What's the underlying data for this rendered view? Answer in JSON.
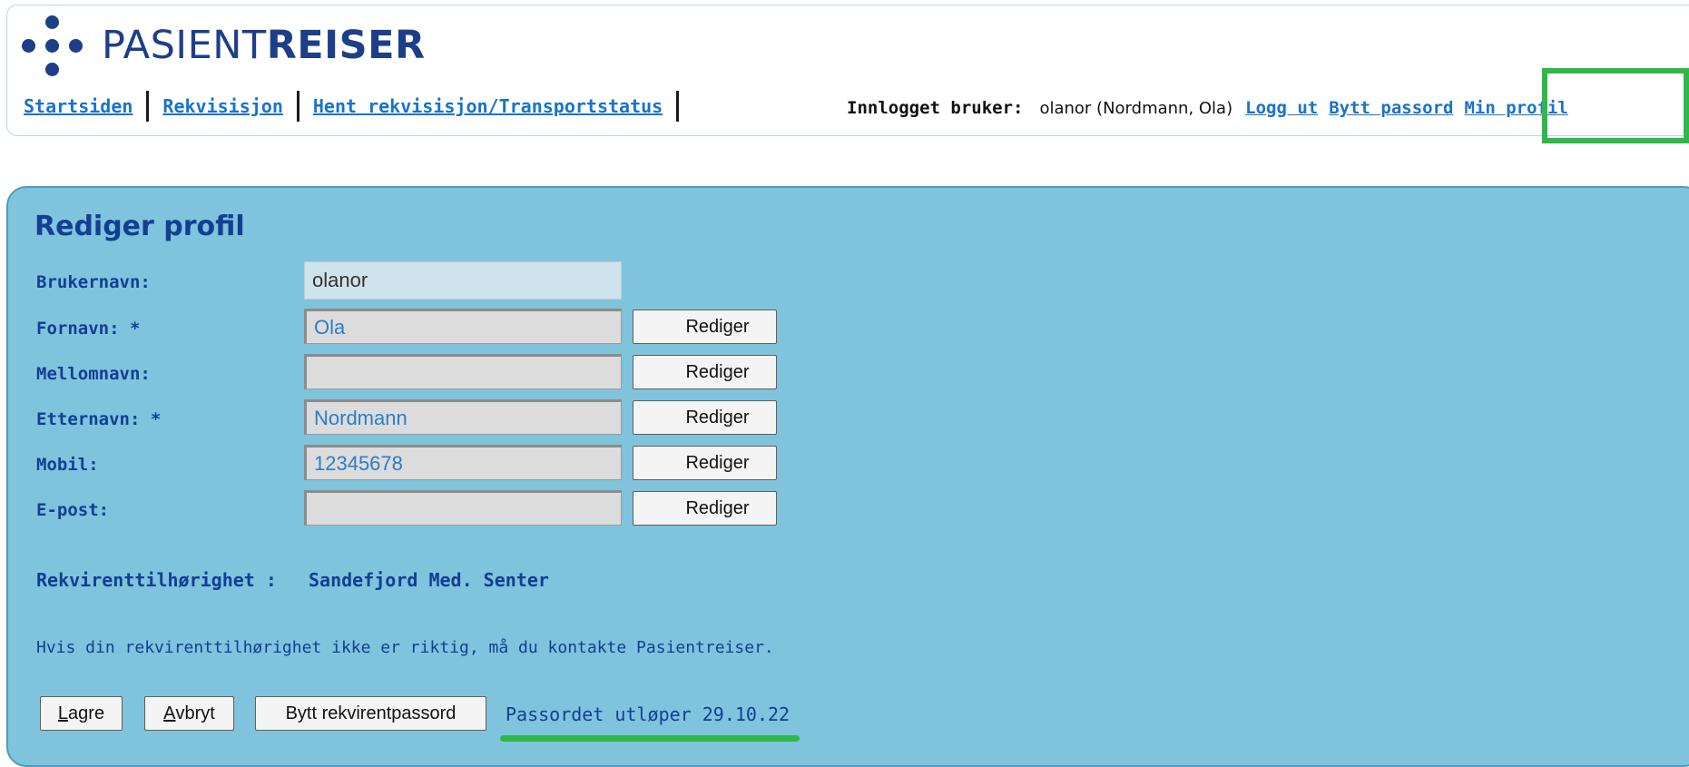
{
  "logo": {
    "text_light": "PASIENT",
    "text_bold": "REISER"
  },
  "nav": {
    "items": [
      {
        "label": "Startsiden"
      },
      {
        "label": "Rekvisisjon"
      },
      {
        "label": "Hent rekvisisjon/Transportstatus"
      }
    ]
  },
  "user": {
    "label": "Innlogget bruker:",
    "name": "olanor (Nordmann, Ola)",
    "logout": "Logg ut",
    "change_password": "Bytt passord",
    "profile": "Min profil"
  },
  "form": {
    "title": "Rediger profil",
    "username": {
      "label": "Brukernavn:",
      "value": "olanor"
    },
    "edit_button_label": "Rediger",
    "fields": [
      {
        "label": "Fornavn: *",
        "value": "Ola"
      },
      {
        "label": "Mellomnavn:",
        "value": ""
      },
      {
        "label": "Etternavn: *",
        "value": "Nordmann"
      },
      {
        "label": "Mobil:",
        "value": "12345678"
      },
      {
        "label": "E-post:",
        "value": ""
      }
    ],
    "affiliation_label": "Rekvirenttilhørighet :",
    "affiliation_value": "Sandefjord Med. Senter",
    "info": "Hvis din rekvirenttilhørighet ikke er riktig, må du kontakte Pasientreiser.",
    "save_first": "L",
    "save_rest": "agre",
    "cancel_first": "A",
    "cancel_rest": "vbryt",
    "change_requester_password": "Bytt rekvirentpassord",
    "password_expiry": "Passordet utløper 29.10.22"
  },
  "colors": {
    "brand": "#1d3f8a",
    "link": "#1a73c8",
    "panel": "#80c3dc",
    "highlight": "#2fb84a"
  }
}
